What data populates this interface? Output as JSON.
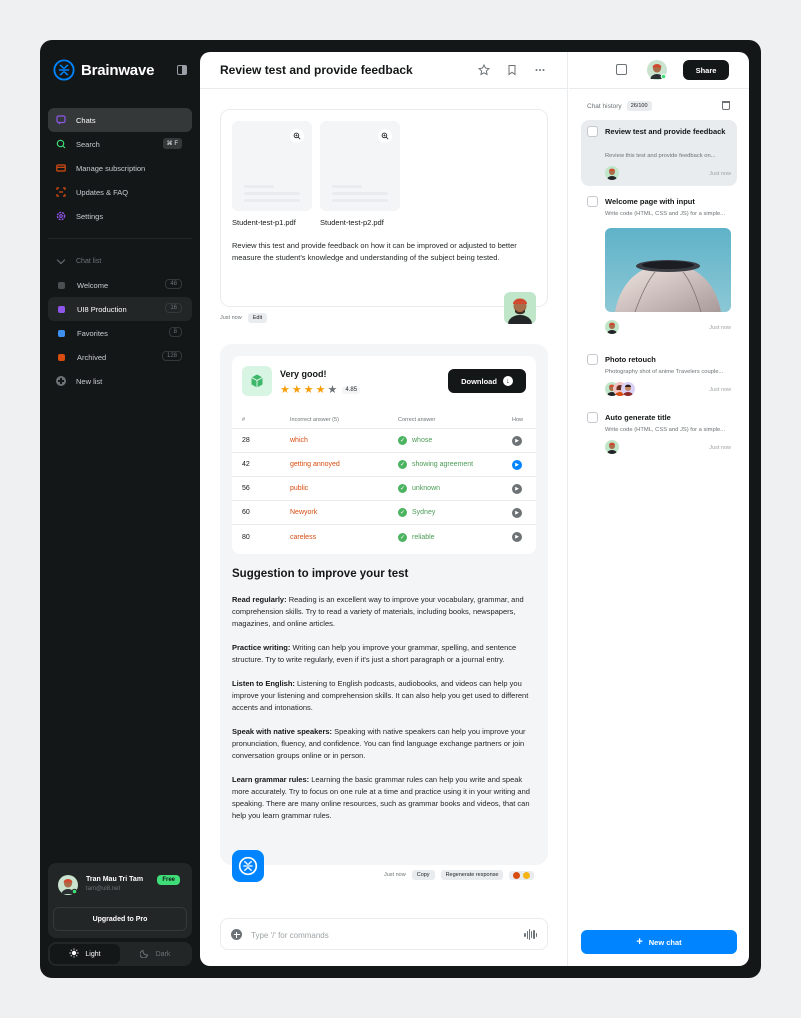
{
  "brand": {
    "name": "Brainwave"
  },
  "nav": [
    {
      "label": "Chats",
      "active": true
    },
    {
      "label": "Search",
      "shortcut": "⌘ F"
    },
    {
      "label": "Manage subscription"
    },
    {
      "label": "Updates & FAQ"
    },
    {
      "label": "Settings"
    }
  ],
  "chat_list": {
    "title": "Chat list",
    "items": [
      {
        "label": "Welcome",
        "count": "48",
        "color": "#4b4f52"
      },
      {
        "label": "UI8 Production",
        "count": "16",
        "color": "#8e55ea",
        "active": true
      },
      {
        "label": "Favorites",
        "count": "8",
        "color": "#3e90f0"
      },
      {
        "label": "Archived",
        "count": "128",
        "color": "#d84c10"
      }
    ],
    "new_list": "New list"
  },
  "user": {
    "name": "Tran Mau Tri Tam",
    "email": "tam@ui8.net",
    "plan": "Free",
    "upgrade": "Upgraded to Pro"
  },
  "theme": {
    "light": "Light",
    "dark": "Dark"
  },
  "header": {
    "title": "Review test and provide feedback"
  },
  "question": {
    "files": [
      "Student-test-p1.pdf",
      "Student-test-p2.pdf"
    ],
    "text": "Review this test and provide feedback on how it can be improved or adjusted to better measure the student's knowledge and understanding of the subject being tested.",
    "time": "Just now",
    "edit": "Edit"
  },
  "result": {
    "title": "Very good!",
    "rating": 4,
    "score": "4.85",
    "download": "Download",
    "columns": [
      "#",
      "Incorrect answer (5)",
      "Correct answer",
      "How"
    ],
    "rows": [
      {
        "num": "28",
        "wrong": "which",
        "right": "whose",
        "playing": false
      },
      {
        "num": "42",
        "wrong": "getting annoyed",
        "right": "showing agreement",
        "playing": true
      },
      {
        "num": "56",
        "wrong": "public",
        "right": "unknown",
        "playing": false
      },
      {
        "num": "60",
        "wrong": "Newyork",
        "right": "Sydney",
        "playing": false
      },
      {
        "num": "80",
        "wrong": "careless",
        "right": "reliable",
        "playing": false
      }
    ]
  },
  "suggestions": {
    "title": "Suggestion to improve your test",
    "items": [
      {
        "head": "Read regularly:",
        "body": " Reading is an excellent way to improve your vocabulary, grammar, and comprehension skills. Try to read a variety of materials, including books, newspapers, magazines, and online articles."
      },
      {
        "head": "Practice writing:",
        "body": " Writing can help you improve your grammar, spelling, and sentence structure. Try to write regularly, even if it's just a short paragraph or a journal entry."
      },
      {
        "head": "Listen to English:",
        "body": " Listening to English podcasts, audiobooks, and videos can help you improve your listening and comprehension skills. It can also help you get used to different accents and intonations."
      },
      {
        "head": "Speak with native speakers:",
        "body": " Speaking with native speakers can help you improve your pronunciation, fluency, and confidence. You can find language exchange partners or join conversation groups online or in person."
      },
      {
        "head": "Learn grammar rules:",
        "body": " Learning the basic grammar rules can help you write and speak more accurately. Try to focus on one rule at a time and practice using it in your writing and speaking. There are many online resources, such as grammar books and videos, that can help you learn grammar rules."
      }
    ]
  },
  "answer_meta": {
    "time": "Just now",
    "copy": "Copy",
    "regenerate": "Regenerate response"
  },
  "composer": {
    "placeholder": "Type '/' for commands"
  },
  "right_panel": {
    "share": "Share",
    "history_title": "Chat history",
    "history_count": "26/100",
    "items": [
      {
        "title": "Review test and provide feedback",
        "snippet": "Review this test and provide feedback on...",
        "time": "Just now"
      },
      {
        "title": "Welcome page with input",
        "snippet": "Write code (HTML, CSS and JS) for a simple...",
        "time": "Just now"
      },
      {
        "title": "Photo retouch",
        "snippet": "Photography shot of anime Travelers couple...",
        "time": "Just now"
      },
      {
        "title": "Auto generate title",
        "snippet": "Write code (HTML, CSS and JS) for a simple...",
        "time": "Just now"
      }
    ],
    "new_chat": "New chat"
  },
  "colors": {
    "accent": "#0084ff",
    "sidebar": "#141718",
    "success": "#4cb361",
    "error": "#d84c10"
  }
}
